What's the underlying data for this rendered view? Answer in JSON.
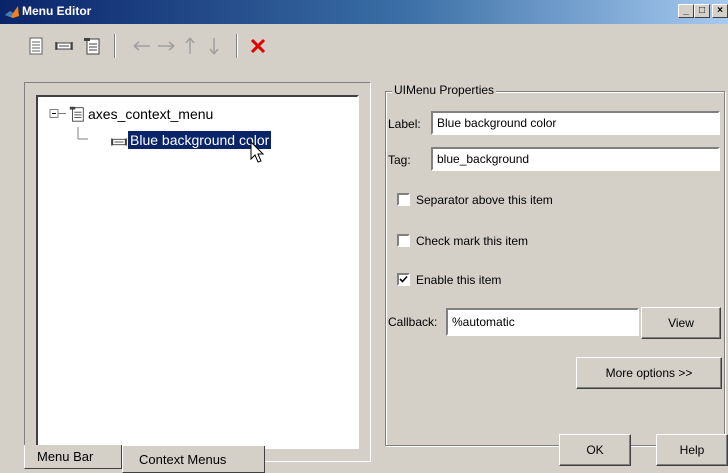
{
  "window": {
    "title": "Menu Editor",
    "buttons": [
      "_",
      "□",
      "×"
    ]
  },
  "toolbar": {
    "icons": [
      "new-menu-icon",
      "new-menu-item-icon",
      "new-context-menu-icon",
      "move-left-icon",
      "move-right-icon",
      "move-up-icon",
      "move-down-icon",
      "delete-icon"
    ]
  },
  "tree": {
    "root": {
      "label": "axes_context_menu",
      "expanded": true
    },
    "child": {
      "label": "Blue background color",
      "selected": true
    }
  },
  "tabs": [
    {
      "label": "Menu Bar",
      "active": false
    },
    {
      "label": "Context Menus",
      "active": true
    }
  ],
  "properties": {
    "group_title": "UIMenu Properties",
    "label": {
      "caption": "Label:",
      "value": "Blue background color"
    },
    "tag": {
      "caption": "Tag:",
      "value": "blue_background"
    },
    "separator": {
      "caption": "Separator above this item",
      "checked": false
    },
    "checkmark": {
      "caption": "Check mark this item",
      "checked": false
    },
    "enable": {
      "caption": "Enable this item",
      "checked": true
    },
    "callback": {
      "caption": "Callback:",
      "value": "%automatic"
    },
    "view_label": "View",
    "more_options_label": "More options >>"
  },
  "footer": {
    "ok_label": "OK",
    "help_label": "Help"
  },
  "colors": {
    "selection": "#0a246a",
    "delete": "#e00000",
    "face": "#d4d0c8"
  }
}
